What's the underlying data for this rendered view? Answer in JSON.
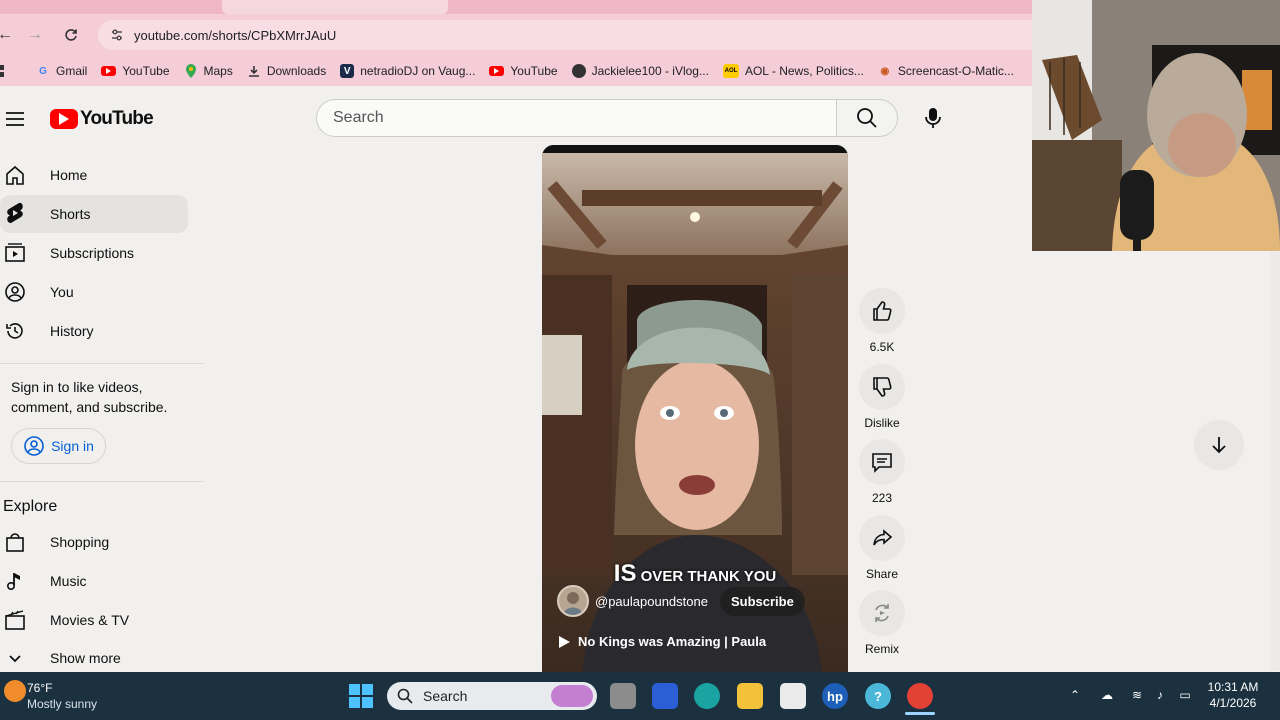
{
  "browser": {
    "url": "youtube.com/shorts/CPbXMrrJAuU",
    "bookmarks": [
      {
        "label": "Gmail",
        "icon": "google-icon"
      },
      {
        "label": "YouTube",
        "icon": "youtube-icon"
      },
      {
        "label": "Maps",
        "icon": "maps-pin-icon"
      },
      {
        "label": "Downloads",
        "icon": "download-icon"
      },
      {
        "label": "netradioDJ on Vaug...",
        "icon": "netradio-icon"
      },
      {
        "label": "YouTube",
        "icon": "youtube-icon"
      },
      {
        "label": "Jackielee100 - iVlog...",
        "icon": "globe-icon"
      },
      {
        "label": "AOL - News, Politics...",
        "icon": "aol-icon"
      },
      {
        "label": "Screencast-O-Matic...",
        "icon": "screencast-icon"
      }
    ]
  },
  "header": {
    "logo_text": "YouTube",
    "search_placeholder": "Search"
  },
  "sidebar": {
    "items": [
      {
        "label": "Home"
      },
      {
        "label": "Shorts"
      },
      {
        "label": "Subscriptions"
      },
      {
        "label": "You"
      },
      {
        "label": "History"
      }
    ],
    "signin_prompt": "Sign in to like videos, comment, and subscribe.",
    "signin_label": "Sign in",
    "explore_heading": "Explore",
    "explore_items": [
      {
        "label": "Shopping"
      },
      {
        "label": "Music"
      },
      {
        "label": "Movies & TV"
      }
    ],
    "show_more": "Show more"
  },
  "short": {
    "caption_big": "IS",
    "caption_small": "OVER THANK YOU",
    "channel": "@paulapoundstone",
    "subscribe_label": "Subscribe",
    "title": "No Kings was Amazing | Paula"
  },
  "actions": {
    "like_count": "6.5K",
    "dislike_label": "Dislike",
    "comment_count": "223",
    "share_label": "Share",
    "remix_label": "Remix"
  },
  "taskbar": {
    "temperature": "76°F",
    "weather": "Mostly sunny",
    "search_placeholder": "Search",
    "time": "10:31 AM",
    "date": "4/1/2026"
  },
  "colors": {
    "yt_red": "#ff0000",
    "link_blue": "#065fd4",
    "browser_pink": "#f4cdd8",
    "taskbar": "#1b3140"
  }
}
